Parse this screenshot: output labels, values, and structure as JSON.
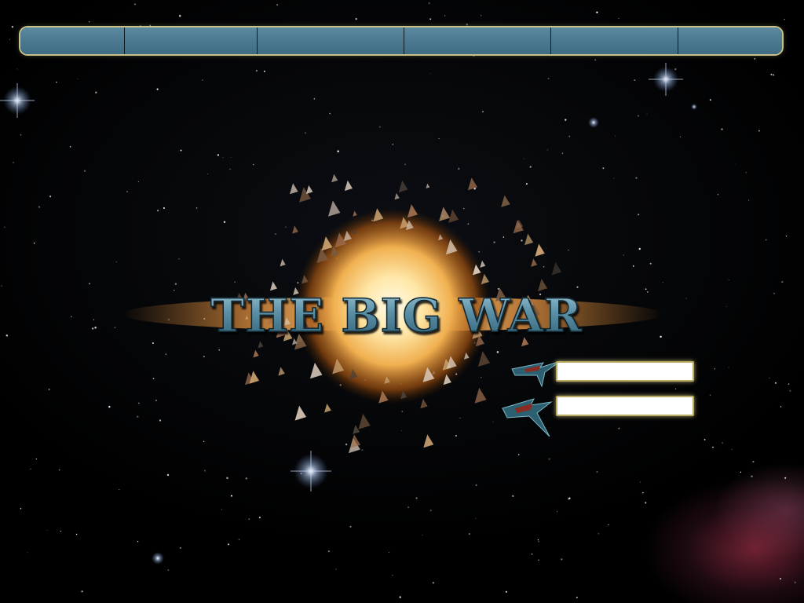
{
  "title": "THE BIG WAR",
  "nav": {
    "items": [
      {
        "label": ""
      },
      {
        "label": ""
      },
      {
        "label": ""
      },
      {
        "label": ""
      },
      {
        "label": ""
      },
      {
        "label": ""
      }
    ]
  },
  "login": {
    "username": {
      "value": "",
      "placeholder": ""
    },
    "password": {
      "value": "",
      "placeholder": ""
    }
  },
  "icons": [
    "ship-icon",
    "ship-icon"
  ],
  "colors": {
    "nav_bar": "#4b7a90",
    "nav_border": "#c9c08a",
    "title": "#5f93a8",
    "field_border": "#b8aa60"
  }
}
